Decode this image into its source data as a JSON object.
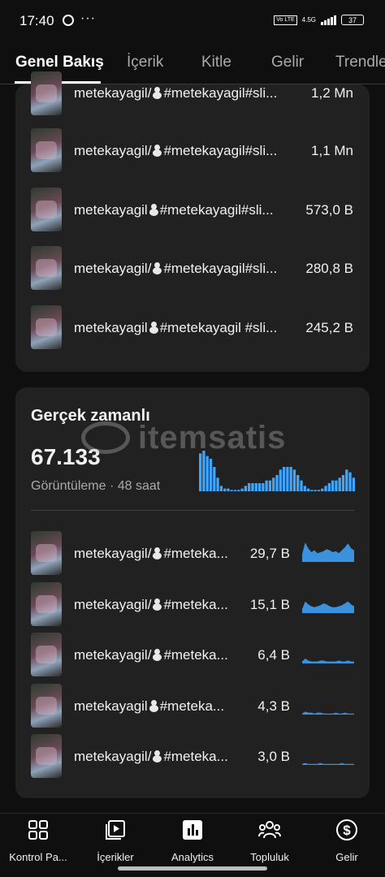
{
  "status": {
    "time": "17:40",
    "dots": "···",
    "lte": "Vo LTE",
    "network": "4.5G",
    "battery": "37"
  },
  "tabs": [
    {
      "label": "Genel Bakış",
      "active": true
    },
    {
      "label": "İçerik"
    },
    {
      "label": "Kitle"
    },
    {
      "label": "Gelir"
    },
    {
      "label": "Trendle"
    }
  ],
  "top_list": [
    {
      "title_a": "metekayagil/",
      "title_b": "#metekayagil#sli...",
      "value": "1,2 Mn"
    },
    {
      "title_a": "metekayagil/",
      "title_b": "#metekayagil#sli...",
      "value": "1,1 Mn"
    },
    {
      "title_a": "metekayagil",
      "title_b": "#metekayagil#sli...",
      "value": "573,0 B"
    },
    {
      "title_a": "metekayagil/",
      "title_b": "#metekayagil#sli...",
      "value": "280,8 B"
    },
    {
      "title_a": "metekayagil",
      "title_b": "#metekayagil #sli...",
      "value": "245,2 B"
    }
  ],
  "realtime": {
    "title": "Gerçek zamanlı",
    "count": "67.133",
    "subtitle": "Görüntüleme · 48 saat",
    "bars": [
      14,
      15,
      13,
      12,
      9,
      5,
      2,
      1,
      1,
      0.5,
      0.5,
      0.5,
      1,
      2,
      3,
      3,
      3,
      3,
      3,
      4,
      4,
      5,
      6,
      8,
      9,
      9,
      9,
      8,
      6,
      4,
      2,
      1,
      0.5,
      0.5,
      0.5,
      1,
      2,
      3,
      4,
      4,
      5,
      6,
      8,
      7,
      5
    ],
    "accent": "#3ea6ff",
    "items": [
      {
        "title_a": "metekayagil/",
        "title_b": "#meteka...",
        "value": "29,7 B",
        "spark": [
          8,
          20,
          14,
          10,
          12,
          9,
          10,
          11,
          13,
          12,
          10,
          11,
          9,
          12,
          15,
          19,
          14,
          12
        ]
      },
      {
        "title_a": "metekayagil/",
        "title_b": "#meteka...",
        "value": "15,1 B",
        "spark": [
          4,
          12,
          9,
          7,
          6,
          7,
          8,
          10,
          9,
          7,
          6,
          6,
          7,
          8,
          10,
          12,
          9,
          7
        ]
      },
      {
        "title_a": "metekayagil/",
        "title_b": "#meteka...",
        "value": "6,4 B",
        "spark": [
          2,
          5,
          3,
          2,
          2,
          2,
          3,
          3,
          2,
          2,
          2,
          2,
          3,
          2,
          2,
          3,
          2,
          2
        ]
      },
      {
        "title_a": "metekayagil",
        "title_b": "#meteka...",
        "value": "4,3 B",
        "spark": [
          1,
          3,
          2,
          2,
          1,
          2,
          2,
          1,
          1,
          1,
          1,
          2,
          1,
          1,
          2,
          1,
          1,
          1
        ]
      },
      {
        "title_a": "metekayagil/",
        "title_b": "#meteka...",
        "value": "3,0 B",
        "spark": [
          1,
          2,
          1,
          1,
          1,
          1,
          2,
          1,
          1,
          1,
          1,
          1,
          1,
          2,
          1,
          1,
          1,
          1
        ]
      }
    ]
  },
  "watermark": "itemsatis",
  "nav": [
    {
      "label": "Kontrol Pa...",
      "icon": "dashboard-icon"
    },
    {
      "label": "İçerikler",
      "icon": "content-icon"
    },
    {
      "label": "Analytics",
      "icon": "analytics-icon"
    },
    {
      "label": "Topluluk",
      "icon": "community-icon"
    },
    {
      "label": "Gelir",
      "icon": "earn-icon"
    }
  ]
}
